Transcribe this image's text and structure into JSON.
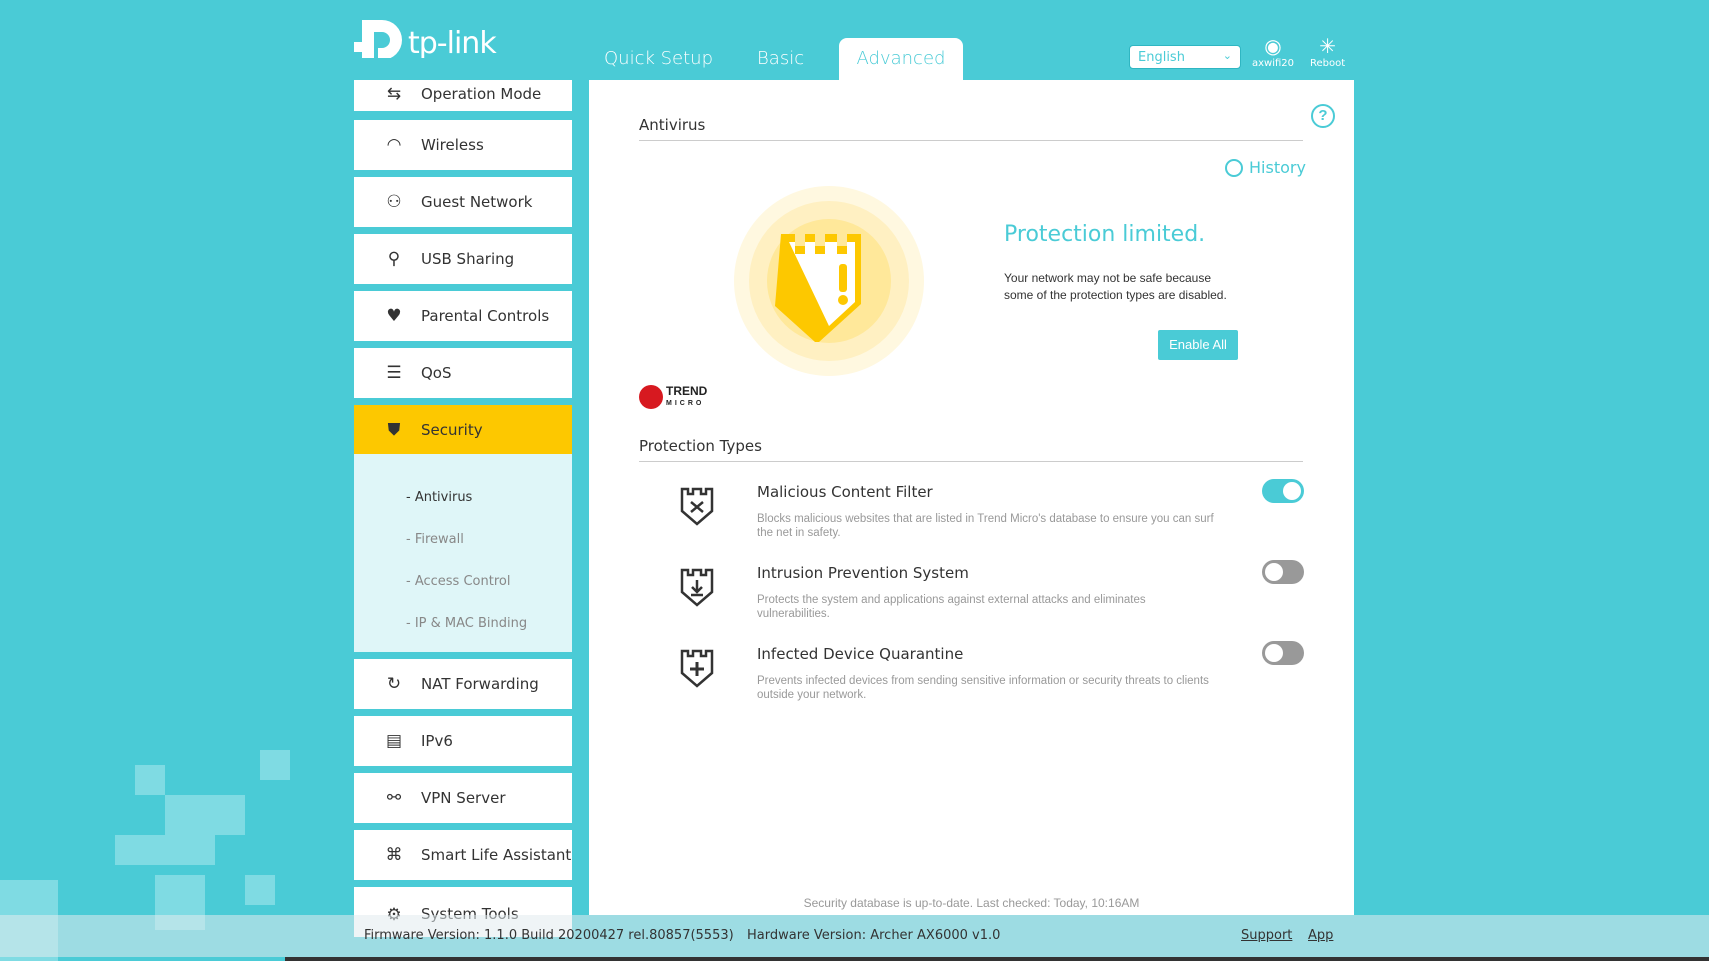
{
  "brand": {
    "name": "tp-link"
  },
  "header": {
    "tabs": [
      {
        "label": "Quick Setup"
      },
      {
        "label": "Basic"
      },
      {
        "label": "Advanced",
        "active": true
      }
    ],
    "language": "English",
    "user": {
      "label": "axwifi20",
      "icon": "user-cloud-icon"
    },
    "reboot": {
      "label": "Reboot",
      "icon": "reboot-icon"
    }
  },
  "sidebar": {
    "items": [
      {
        "label": "Operation Mode",
        "icon": "operation-mode-icon"
      },
      {
        "label": "Wireless",
        "icon": "wireless-icon"
      },
      {
        "label": "Guest Network",
        "icon": "guest-network-icon"
      },
      {
        "label": "USB Sharing",
        "icon": "usb-icon"
      },
      {
        "label": "Parental Controls",
        "icon": "parental-controls-icon"
      },
      {
        "label": "QoS",
        "icon": "qos-icon"
      },
      {
        "label": "Security",
        "icon": "shield-icon",
        "selected": true
      },
      {
        "label": "NAT Forwarding",
        "icon": "nat-icon"
      },
      {
        "label": "IPv6",
        "icon": "ipv6-icon"
      },
      {
        "label": "VPN Server",
        "icon": "vpn-icon"
      },
      {
        "label": "Smart Life Assistant",
        "icon": "smart-life-icon"
      },
      {
        "label": "System Tools",
        "icon": "gear-icon"
      }
    ],
    "security_sub": [
      "- Antivirus",
      "- Firewall",
      "- Access Control",
      "- IP & MAC Binding"
    ]
  },
  "main": {
    "title": "Antivirus",
    "history": "History",
    "status": {
      "title": "Protection limited.",
      "line1": "Your network may not be safe because",
      "line2": "some of the protection types are disabled.",
      "enable_all": "Enable All"
    },
    "vendor": "TREND MICRO",
    "types_title": "Protection Types",
    "types": [
      {
        "title": "Malicious Content Filter",
        "desc": "Blocks malicious websites that are listed in Trend Micro's database to ensure you can surf the net in safety.",
        "enabled": true
      },
      {
        "title": "Intrusion Prevention System",
        "desc": "Protects the system and applications against external attacks and eliminates vulnerabilities.",
        "enabled": false
      },
      {
        "title": "Infected Device Quarantine",
        "desc": "Prevents infected devices from sending sensitive information or security threats to clients outside your network.",
        "enabled": false
      }
    ],
    "db_status": "Security database is up-to-date. Last checked: Today, 10:16AM"
  },
  "footer": {
    "firmware": "Firmware Version: 1.1.0 Build 20200427 rel.80857(5553)",
    "hardware": "Hardware Version: Archer AX6000 v1.0",
    "support": "Support",
    "app": "App"
  },
  "colors": {
    "accent": "#4acbd6",
    "warning": "#fdc800"
  }
}
